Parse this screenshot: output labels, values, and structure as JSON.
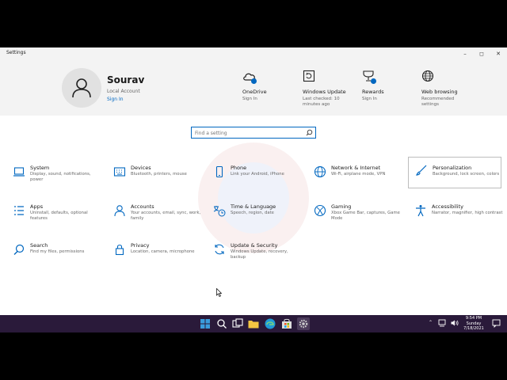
{
  "window": {
    "title": "Settings"
  },
  "header": {
    "user_name": "Sourav",
    "account_type": "Local Account",
    "sign_in": "Sign In",
    "items": [
      {
        "name": "OneDrive",
        "sub": "Sign In"
      },
      {
        "name": "Windows Update",
        "sub": "Last checked: 10 minutes ago"
      },
      {
        "name": "Rewards",
        "sub": "Sign In"
      },
      {
        "name": "Web browsing",
        "sub": "Recommended settings"
      }
    ]
  },
  "search": {
    "placeholder": "Find a setting"
  },
  "tiles": [
    {
      "name": "System",
      "desc": "Display, sound, notifications, power",
      "icon": "laptop-icon"
    },
    {
      "name": "Devices",
      "desc": "Bluetooth, printers, mouse",
      "icon": "keyboard-icon"
    },
    {
      "name": "Phone",
      "desc": "Link your Android, iPhone",
      "icon": "phone-icon"
    },
    {
      "name": "Network & Internet",
      "desc": "Wi-Fi, airplane mode, VPN",
      "icon": "globe-icon"
    },
    {
      "name": "Personalization",
      "desc": "Background, lock screen, colors",
      "icon": "brush-icon"
    },
    {
      "name": "Apps",
      "desc": "Uninstall, defaults, optional features",
      "icon": "apps-list-icon"
    },
    {
      "name": "Accounts",
      "desc": "Your accounts, email, sync, work, family",
      "icon": "person-icon"
    },
    {
      "name": "Time & Language",
      "desc": "Speech, region, date",
      "icon": "time-language-icon"
    },
    {
      "name": "Gaming",
      "desc": "Xbox Game Bar, captures, Game Mode",
      "icon": "xbox-icon"
    },
    {
      "name": "Accessibility",
      "desc": "Narrator, magnifier, high contrast",
      "icon": "accessibility-icon"
    },
    {
      "name": "Search",
      "desc": "Find my files, permissions",
      "icon": "search-icon"
    },
    {
      "name": "Privacy",
      "desc": "Location, camera, microphone",
      "icon": "lock-icon"
    },
    {
      "name": "Update & Security",
      "desc": "Windows Update, recovery, backup",
      "icon": "sync-icon"
    }
  ],
  "taskbar": {
    "time": "9:54 PM",
    "day": "Sunday",
    "date": "7/18/2021"
  },
  "colors": {
    "accent": "#0067c0",
    "header_bg": "#f3f3f3",
    "taskbar_bg": "#2a1a3a"
  }
}
